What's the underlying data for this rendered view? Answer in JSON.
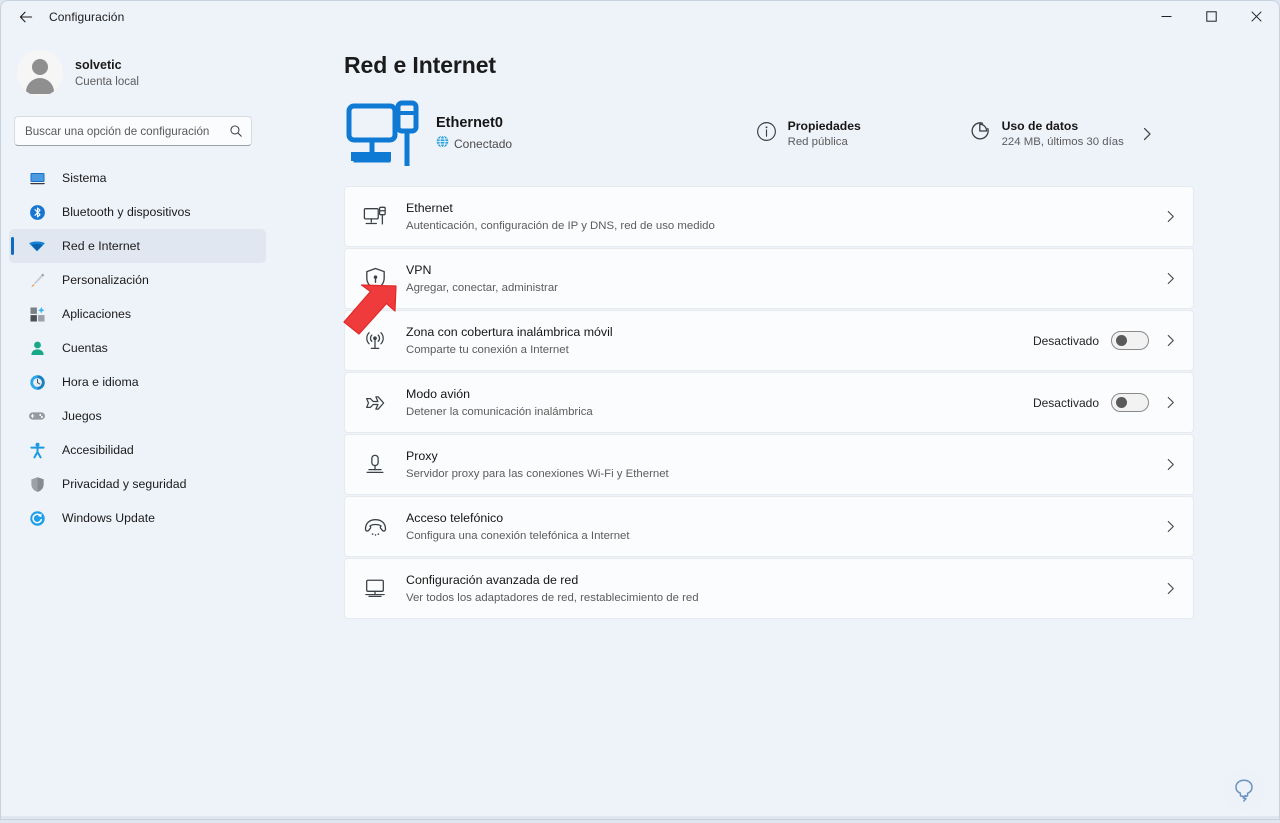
{
  "window": {
    "title": "Configuración",
    "back_icon": "back-arrow-icon",
    "minimize_label": "—",
    "maximize_label": "□",
    "close_label": "✕"
  },
  "sidebar": {
    "profile": {
      "name": "solvetic",
      "account_type": "Cuenta local",
      "avatar_icon": "user-avatar-icon"
    },
    "search": {
      "placeholder": "Buscar una opción de configuración",
      "value": "",
      "icon": "search-icon"
    },
    "items": [
      {
        "label": "Sistema",
        "icon": "system-icon",
        "active": false
      },
      {
        "label": "Bluetooth y dispositivos",
        "icon": "bluetooth-icon",
        "active": false
      },
      {
        "label": "Red e Internet",
        "icon": "network-wifi-icon",
        "active": true
      },
      {
        "label": "Personalización",
        "icon": "paintbrush-icon",
        "active": false
      },
      {
        "label": "Aplicaciones",
        "icon": "apps-icon",
        "active": false
      },
      {
        "label": "Cuentas",
        "icon": "accounts-icon",
        "active": false
      },
      {
        "label": "Hora e idioma",
        "icon": "clock-globe-icon",
        "active": false
      },
      {
        "label": "Juegos",
        "icon": "gamepad-icon",
        "active": false
      },
      {
        "label": "Accesibilidad",
        "icon": "accessibility-icon",
        "active": false
      },
      {
        "label": "Privacidad y seguridad",
        "icon": "shield-icon",
        "active": false
      },
      {
        "label": "Windows Update",
        "icon": "update-refresh-icon",
        "active": false
      }
    ]
  },
  "main": {
    "page_title": "Red e Internet",
    "status": {
      "adapter_icon": "ethernet-monitor-icon",
      "adapter_name": "Ethernet0",
      "connection_icon": "globe-icon",
      "connection_state": "Conectado",
      "properties": {
        "icon": "info-circle-icon",
        "title": "Propiedades",
        "subtitle": "Red pública"
      },
      "data_usage": {
        "icon": "pie-chart-icon",
        "title": "Uso de datos",
        "subtitle": "224 MB, últimos 30 días",
        "chevron": "chevron-right-icon"
      }
    },
    "rows": [
      {
        "icon": "ethernet-icon",
        "title": "Ethernet",
        "subtitle": "Autenticación, configuración de IP y DNS, red de uso medido",
        "toggle": null,
        "chevron": "chevron-right-icon"
      },
      {
        "icon": "vpn-shield-icon",
        "title": "VPN",
        "subtitle": "Agregar, conectar, administrar",
        "toggle": null,
        "chevron": "chevron-right-icon"
      },
      {
        "icon": "hotspot-icon",
        "title": "Zona con cobertura inalámbrica móvil",
        "subtitle": "Comparte tu conexión a Internet",
        "toggle": {
          "label": "Desactivado",
          "on": false
        },
        "chevron": "chevron-right-icon"
      },
      {
        "icon": "airplane-icon",
        "title": "Modo avión",
        "subtitle": "Detener la comunicación inalámbrica",
        "toggle": {
          "label": "Desactivado",
          "on": false
        },
        "chevron": "chevron-right-icon"
      },
      {
        "icon": "proxy-icon",
        "title": "Proxy",
        "subtitle": "Servidor proxy para las conexiones Wi-Fi y Ethernet",
        "toggle": null,
        "chevron": "chevron-right-icon"
      },
      {
        "icon": "dialup-phone-icon",
        "title": "Acceso telefónico",
        "subtitle": "Configura una conexión telefónica a Internet",
        "toggle": null,
        "chevron": "chevron-right-icon"
      },
      {
        "icon": "advanced-network-icon",
        "title": "Configuración avanzada de red",
        "subtitle": "Ver todos los adaptadores de red, restablecimiento de red",
        "toggle": null,
        "chevron": "chevron-right-icon"
      }
    ]
  },
  "feedback": {
    "icon": "feedback-hub-icon"
  },
  "annotation": {
    "icon": "red-arrow-icon",
    "points_to": "VPN"
  },
  "colors": {
    "accent": "#0f6cbd",
    "page_background": "#eef2f9",
    "card_background": "#fbfcfd",
    "annotation_red": "#ef3b3b",
    "text_primary": "#161616",
    "text_secondary": "#5c5c5c"
  }
}
